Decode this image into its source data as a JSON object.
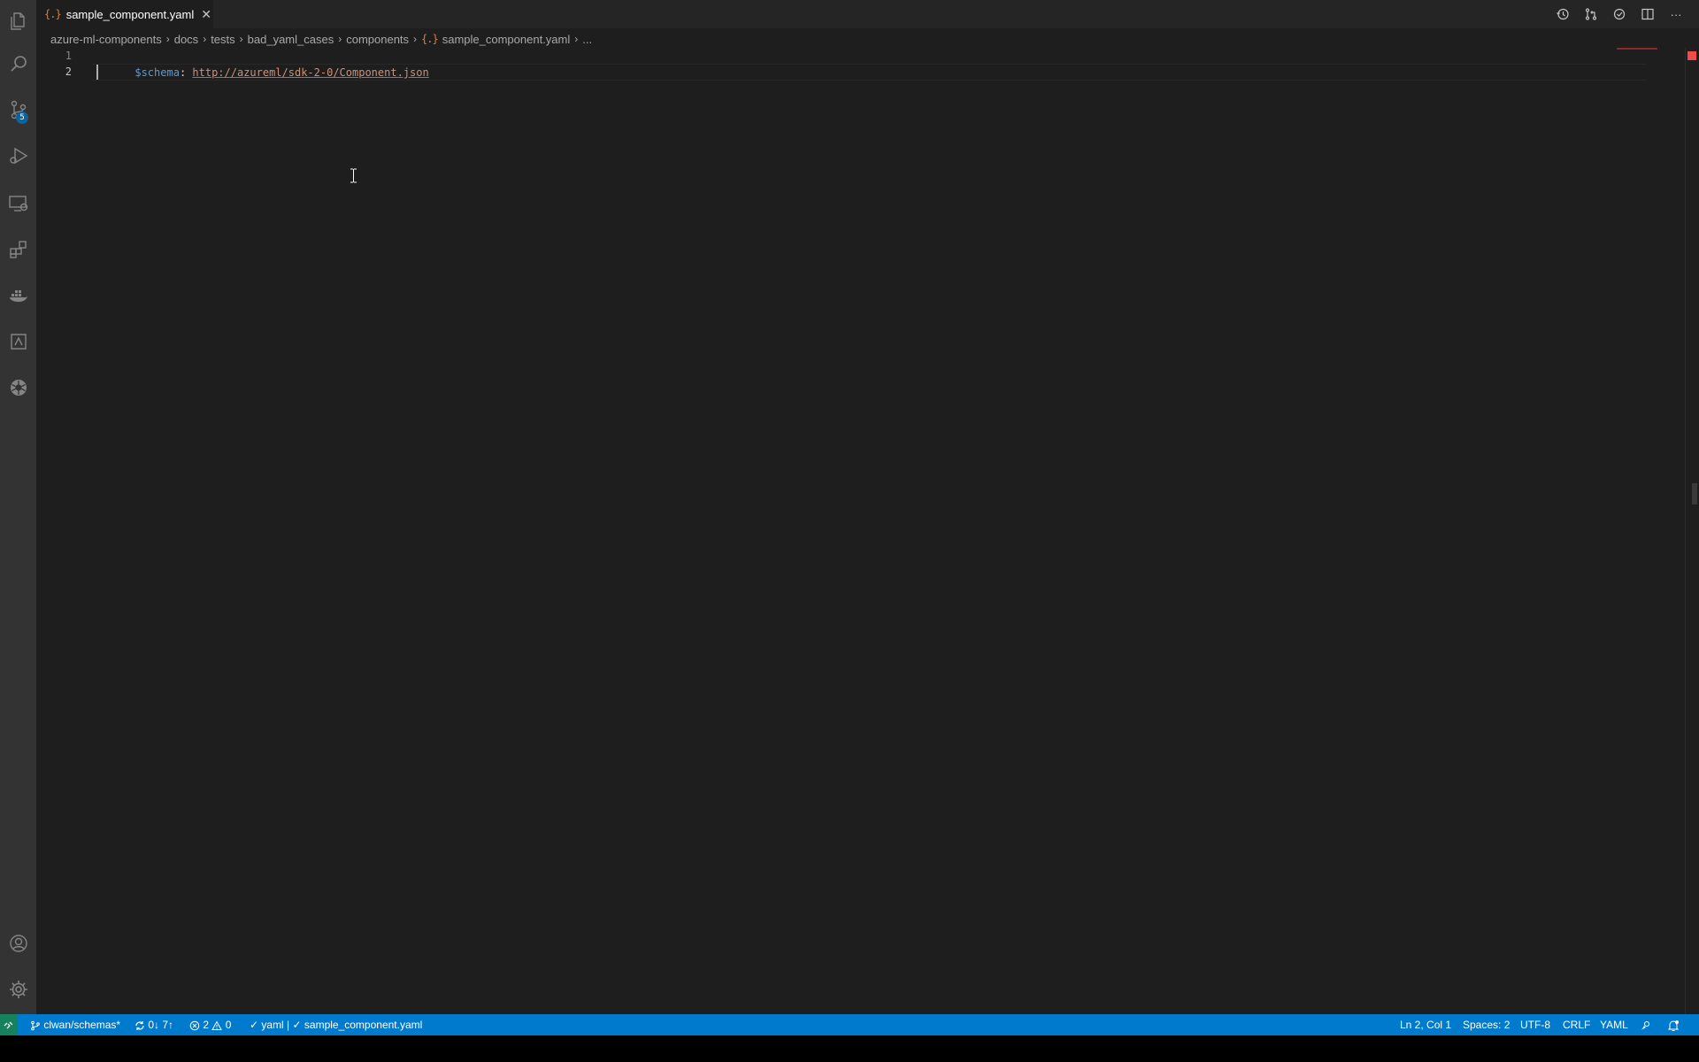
{
  "tab": {
    "icon": "{.}",
    "label": "sample_component.yaml",
    "close": "✕"
  },
  "editor_actions": [
    "history-icon",
    "compare-icon",
    "sync-icon",
    "split-editor-icon",
    "more-actions-icon"
  ],
  "more_label": "···",
  "breadcrumb": {
    "items": [
      "azure-ml-components",
      "docs",
      "tests",
      "bad_yaml_cases",
      "components"
    ],
    "file_icon": "{.}",
    "file": "sample_component.yaml",
    "ellipsis": "...",
    "separator": "›"
  },
  "code": {
    "line_numbers": [
      "1",
      "2"
    ],
    "line1_key": "$schema",
    "line1_colon": ": ",
    "line1_url": "http://azureml/sdk-2-0/Component.json"
  },
  "activity_bar": {
    "items": [
      "explorer-icon",
      "search-icon",
      "source-control-icon",
      "run-debug-icon",
      "remote-explorer-icon",
      "extensions-icon",
      "docker-icon",
      "azure-icon",
      "kubernetes-icon"
    ],
    "source_control_badge": "5",
    "bottom": [
      "accounts-icon",
      "settings-gear-icon"
    ]
  },
  "statusbar": {
    "branch": "clwan/schemas*",
    "sync": "0↓ 7↑",
    "errors": "2",
    "warnings": "0",
    "yaml_status": "✓ yaml | ✓ sample_component.yaml",
    "position": "Ln 2, Col 1",
    "spaces": "Spaces: 2",
    "encoding": "UTF-8",
    "eol": "CRLF",
    "language": "YAML"
  },
  "colors": {
    "statusbar": "#007acc",
    "remote": "#16825d",
    "editor_bg": "#1e1e1e",
    "activity_bar": "#333333"
  }
}
